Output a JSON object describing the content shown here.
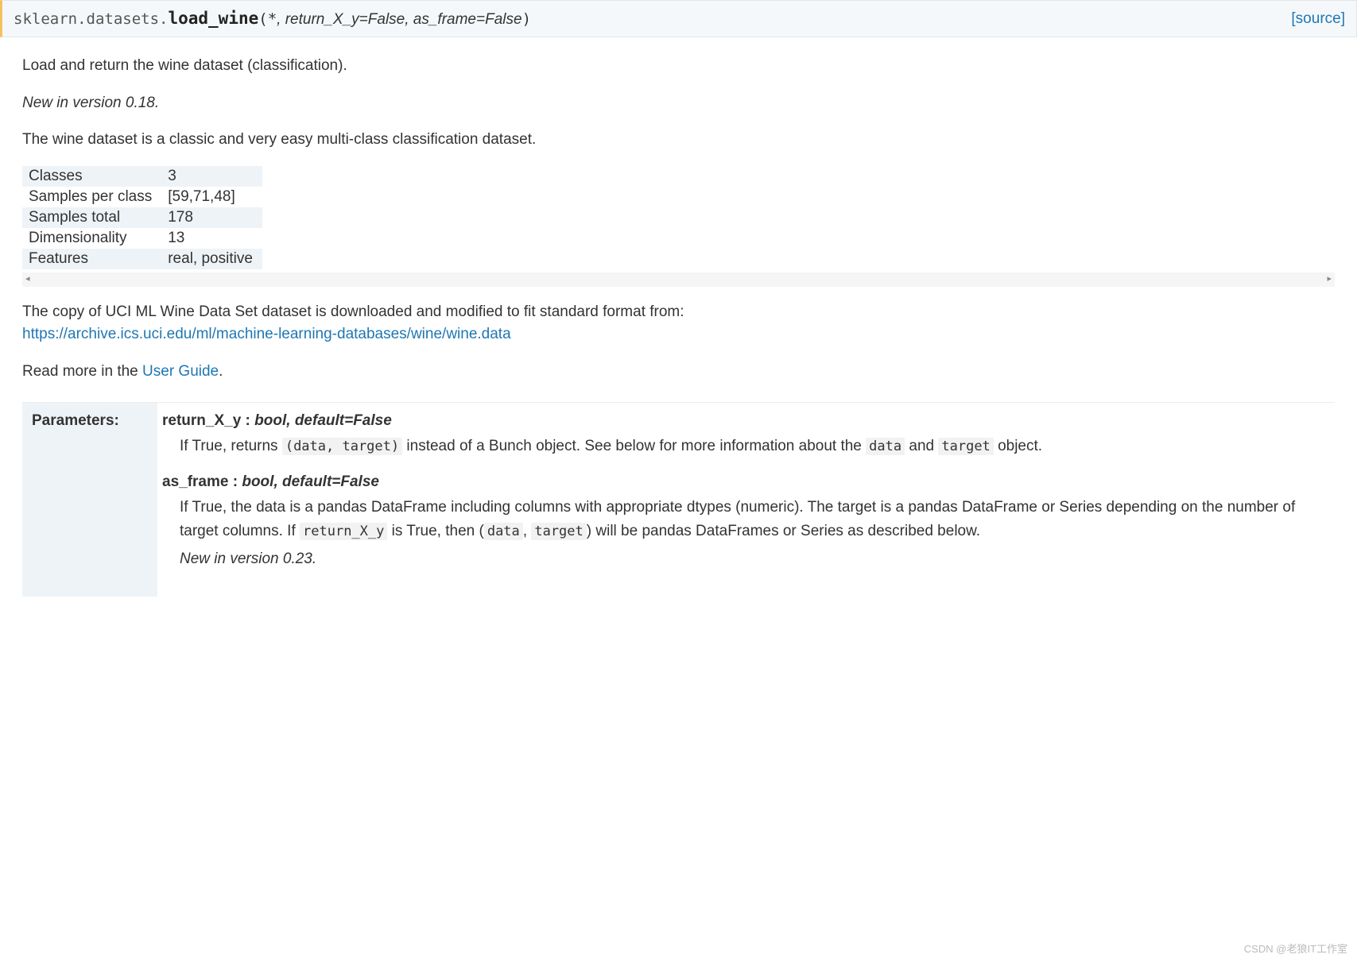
{
  "signature": {
    "module": "sklearn.datasets.",
    "func": "load_wine",
    "open": "(",
    "star": "*",
    "sep1": ", ",
    "p1": "return_X_y=False",
    "sep2": ", ",
    "p2": "as_frame=False",
    "close": ")",
    "source": "[source]"
  },
  "intro": {
    "p1": "Load and return the wine dataset (classification).",
    "version": "New in version 0.18.",
    "p2": "The wine dataset is a classic and very easy multi-class classification dataset."
  },
  "table": {
    "r0k": "Classes",
    "r0v": "3",
    "r1k": "Samples per class",
    "r1v": "[59,71,48]",
    "r2k": "Samples total",
    "r2v": "178",
    "r3k": "Dimensionality",
    "r3v": "13",
    "r4k": "Features",
    "r4v": "real, positive"
  },
  "scroll": {
    "left": "◂",
    "right": "▸"
  },
  "after": {
    "p1": "The copy of UCI ML Wine Data Set dataset is downloaded and modified to fit standard format from:",
    "link": "https://archive.ics.uci.edu/ml/machine-learning-databases/wine/wine.data",
    "p2a": "Read more in the ",
    "p2link": "User Guide",
    "p2b": "."
  },
  "params": {
    "heading": "Parameters:",
    "p1": {
      "name": "return_X_y",
      "colon": " : ",
      "type": "bool, default=False",
      "d1a": "If True, returns ",
      "c1": "(data, target)",
      "d1b": " instead of a Bunch object. See below for more information about the ",
      "c2": "data",
      "d1c": " and ",
      "c3": "target",
      "d1d": " object."
    },
    "p2": {
      "name": "as_frame",
      "colon": " : ",
      "type": "bool, default=False",
      "d1a": "If True, the data is a pandas DataFrame including columns with appropriate dtypes (numeric). The target is a pandas DataFrame or Series depending on the number of target columns. If ",
      "c1": "return_X_y",
      "d1b": " is True, then (",
      "c2": "data",
      "d1c": ", ",
      "c3": "target",
      "d1d": ") will be pandas DataFrames or Series as described below.",
      "version": "New in version 0.23."
    }
  },
  "watermark": "CSDN @老狼IT工作室"
}
